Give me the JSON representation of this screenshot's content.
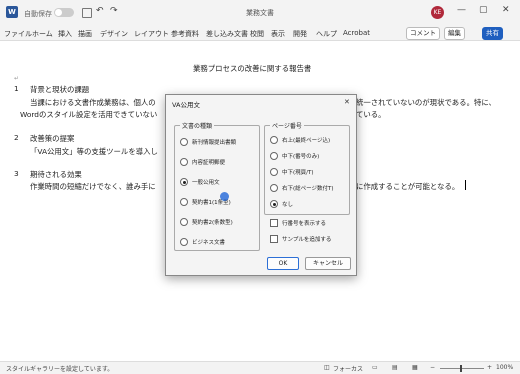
{
  "titlebar": {
    "autosave_label": "自動保存",
    "autosave_state": "オフ",
    "title": "業務文書",
    "avatar_initials": "KE",
    "minimize": "—",
    "maximize": "▢",
    "close": "✕"
  },
  "ribbon": {
    "tabs": [
      "ファイル",
      "ホーム",
      "挿入",
      "描画",
      "デザイン",
      "レイアウト",
      "参考資料",
      "差し込み文書",
      "校閲",
      "表示",
      "開発",
      "ヘルプ",
      "Acrobat"
    ],
    "comment_label": "コメント",
    "edit_label": "編集",
    "share_label": "共有"
  },
  "document": {
    "title": "業務プロセスの改善に関する報告書",
    "s1_heading": "背景と現状の課題",
    "s1_line1_a": "当課における文書作成業務は、個人の",
    "s1_line1_b": "統一されていないのが現状である。特に、",
    "s1_line2_a": "Wordのスタイル設定を活用できていない",
    "s1_line2_b": "ている。",
    "s2_heading": "改善策の提案",
    "s2_line1": "「VA公用文」等の支援ツールを導入し",
    "s3_heading": "期待される効果",
    "s3_line1_a": "作業時間の短縮だけでなく、誰み手に",
    "s3_line1_b": "に作成することが可能となる。",
    "num1": "1",
    "num2": "2",
    "num3": "3"
  },
  "dialog": {
    "title": "VA公用文",
    "close": "✕",
    "doc_type_label": "文書の種類",
    "doc_types": [
      "新刊情報提出書類",
      "内容証明郵便",
      "一般公用文",
      "契約書1(1条型)",
      "契約書2(条数型)",
      "ビジネス文書"
    ],
    "doc_type_selected": 2,
    "page_num_label": "ページ番号",
    "page_nums": [
      "右上(最終ページ込)",
      "中下(番号のみ)",
      "中下(現頁/T)",
      "右下(総ページ数付T)",
      "なし"
    ],
    "page_num_selected": 4,
    "check_line_numbers": "行番号を表示する",
    "check_sample": "サンプルを追加する",
    "ok": "OK",
    "cancel": "キャンセル"
  },
  "status": {
    "message": "スタイルギャラリーを設定しています。",
    "focus": "フォーカス",
    "zoom": "100%"
  }
}
